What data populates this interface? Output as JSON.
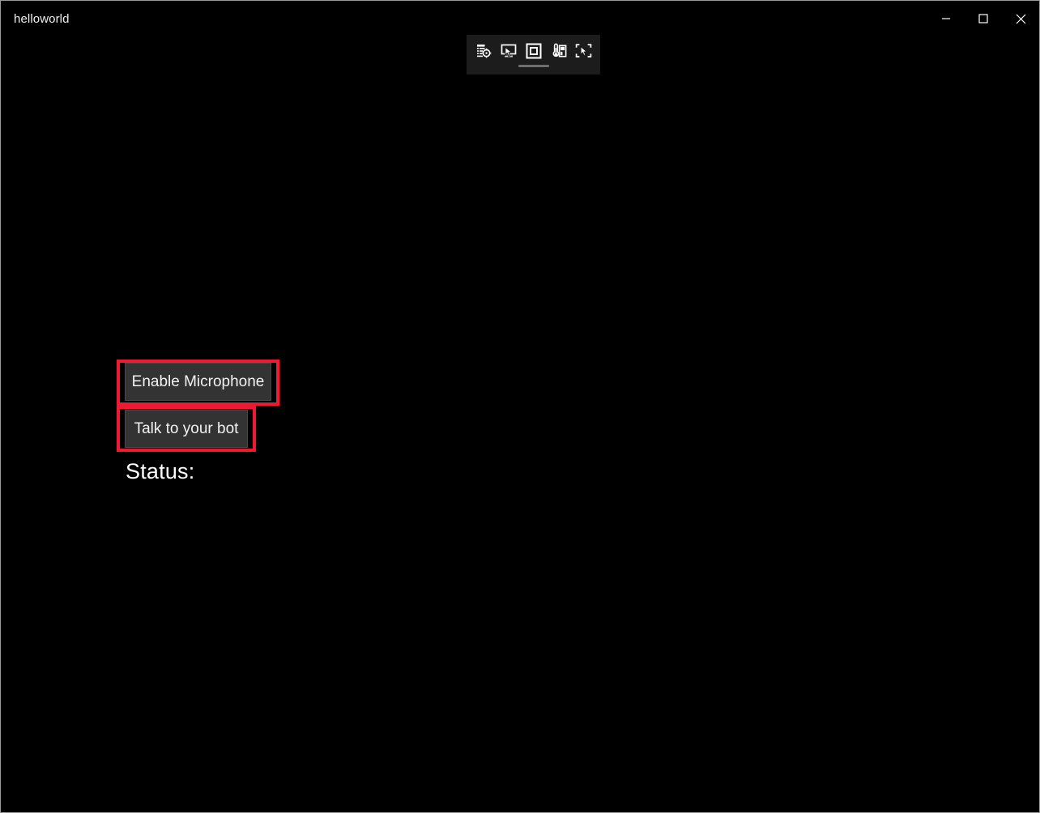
{
  "window": {
    "title": "helloworld",
    "background_color": "#000000",
    "frame_border_color": "#9a9a9a"
  },
  "title_bar": {
    "controls": [
      {
        "name": "minimize",
        "label": "Minimize",
        "glyph": "minimize-icon"
      },
      {
        "name": "maximize",
        "label": "Maximize",
        "glyph": "maximize-icon"
      },
      {
        "name": "close",
        "label": "Close",
        "glyph": "close-icon"
      }
    ]
  },
  "vs_toolbar": {
    "tooltip": "XAML in-app toolbar",
    "buttons": [
      {
        "name": "go-to-live-visual-tree",
        "label": "Go to Live Visual Tree",
        "icon": "live-visual-tree-icon"
      },
      {
        "name": "enable-selection",
        "label": "Enable selection",
        "icon": "selection-cursor-icon"
      },
      {
        "name": "display-layout-adorners",
        "label": "Display layout adorners",
        "icon": "layout-adorners-icon"
      },
      {
        "name": "track-focused-element",
        "label": "Track focused element",
        "icon": "hot-reload-thermometer-icon"
      },
      {
        "name": "select-element-in-running-application",
        "label": "Select element in running application",
        "icon": "select-element-icon"
      }
    ],
    "grip": "drag-handle"
  },
  "main": {
    "buttons": [
      {
        "name": "enable-microphone",
        "label": "Enable Microphone",
        "highlighted": true
      },
      {
        "name": "talk-to-your-bot",
        "label": "Talk to your bot",
        "highlighted": true
      }
    ],
    "status": {
      "label": "Status:",
      "value": ""
    }
  },
  "colors": {
    "highlight": "#ee1933",
    "button_background": "#333333",
    "button_text": "#f2f2f2",
    "toolbar_background": "#1c1c1c",
    "text_primary": "#ffffff"
  }
}
